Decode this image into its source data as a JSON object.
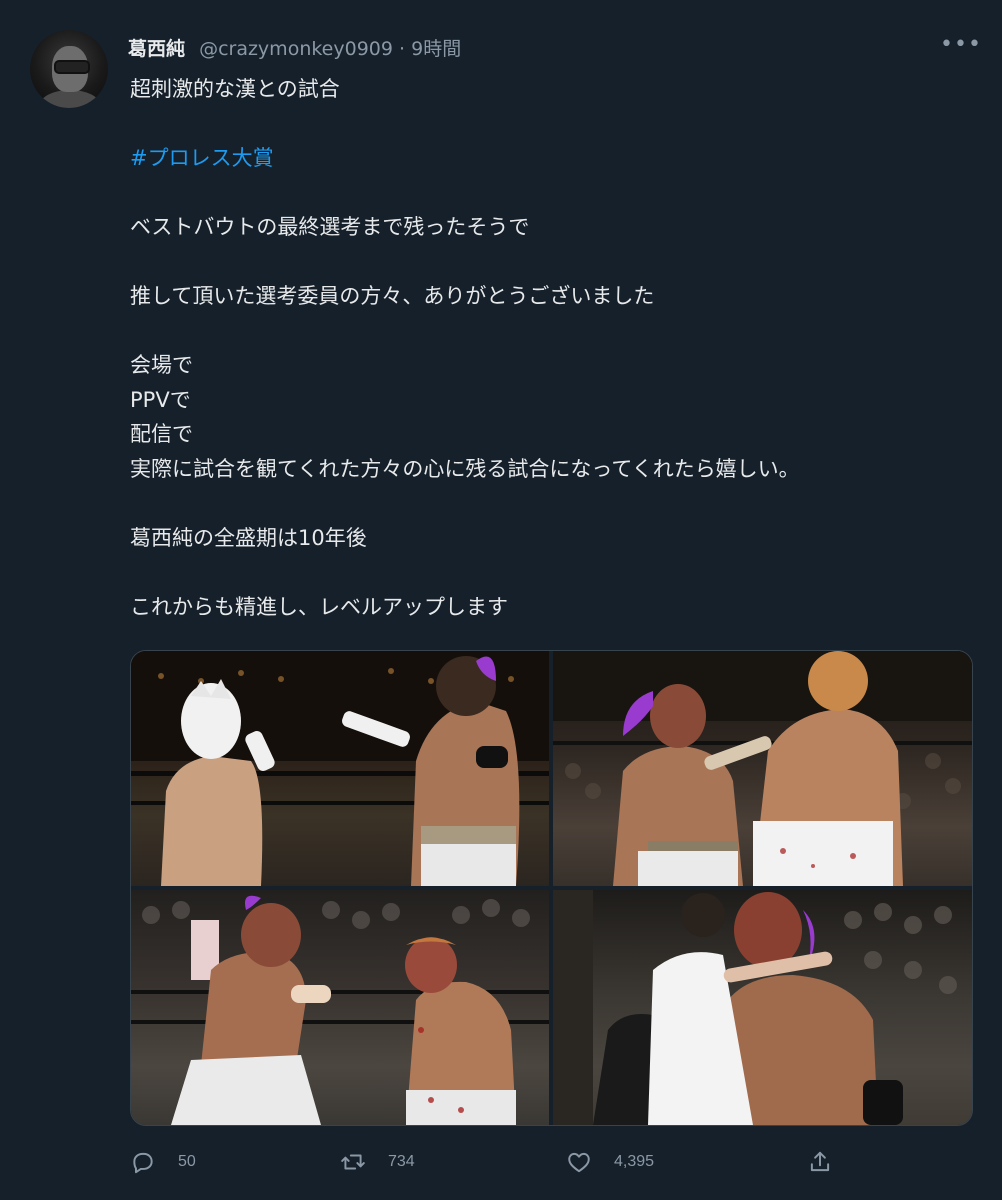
{
  "tweet": {
    "author_name": "葛西純",
    "handle": "@crazymonkey0909",
    "separator": "·",
    "time": "9時間",
    "more_label": "•••",
    "lines": [
      "超刺激的な漢との試合",
      "",
      "#プロレス大賞",
      "",
      "ベストバウトの最終選考まで残ったそうで",
      "",
      "推して頂いた選考委員の方々、ありがとうございました",
      "",
      "会場で",
      "PPVで",
      "配信で",
      "実際に試合を観てくれた方々の心に残る試合になってくれたら嬉しい。",
      "",
      "葛西純の全盛期は10年後",
      "",
      "これからも精進し、レベルアップします"
    ]
  },
  "media": {
    "photos": [
      {
        "icon": "wrestling-photo-icon"
      },
      {
        "icon": "wrestling-photo-icon"
      },
      {
        "icon": "wrestling-photo-icon"
      },
      {
        "icon": "wrestling-photo-icon"
      }
    ]
  },
  "actions": {
    "reply_count": "50",
    "retweet_count": "734",
    "like_count": "4,395"
  },
  "colors": {
    "background": "#15202b",
    "text": "#e7e9ea",
    "muted": "#8b98a5",
    "link": "#1d9bf0"
  }
}
